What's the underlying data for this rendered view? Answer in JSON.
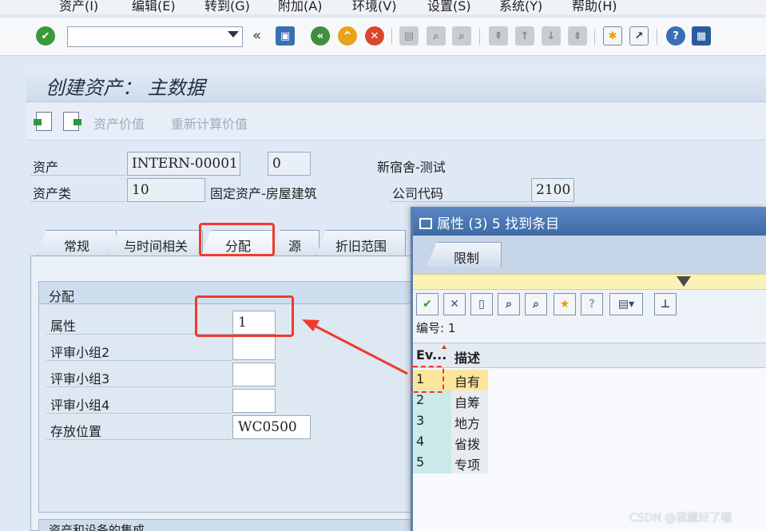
{
  "menu": [
    "资产(I)",
    "编辑(E)",
    "转到(G)",
    "附加(A)",
    "环境(V)",
    "设置(S)",
    "系统(Y)",
    "帮助(H)"
  ],
  "toolbar": {
    "command_value": "",
    "back_chevrons": "«"
  },
  "title": "创建资产：  主数据",
  "app_toolbar": {
    "asset_values": "资产价值",
    "recalc_values": "重新计算价值"
  },
  "header": {
    "asset_label": "资产",
    "asset_number": "INTERN-00001",
    "sub_number": "0",
    "asset_desc": "新宿舍-测试",
    "class_label": "资产类",
    "class_value": "10",
    "class_desc": "固定资产-房屋建筑",
    "company_label": "公司代码",
    "company_value": "2100"
  },
  "tabs": [
    "常规",
    "与时间相关",
    "分配",
    "源",
    "折旧范围"
  ],
  "group": {
    "title": "分配",
    "fields": [
      {
        "label": "属性",
        "value": "1"
      },
      {
        "label": "评审小组2",
        "value": ""
      },
      {
        "label": "评审小组3",
        "value": ""
      },
      {
        "label": "评审小组4",
        "value": ""
      },
      {
        "label": "存放位置",
        "value": "WC0500"
      }
    ],
    "next_group_title": "资产和设备的集成"
  },
  "popup": {
    "title": "属性 (3)   5 找到条目",
    "tab": "限制",
    "number_label": "编号: 1",
    "col_key": "Ev...",
    "col_desc": "描述",
    "rows": [
      {
        "key": "1",
        "desc": "自有"
      },
      {
        "key": "2",
        "desc": "自筹"
      },
      {
        "key": "3",
        "desc": "地方"
      },
      {
        "key": "4",
        "desc": "省拨"
      },
      {
        "key": "5",
        "desc": "专项"
      }
    ]
  },
  "watermark": "CSDN @我藏好了喔",
  "colors": {
    "annotation": "#f03a2c",
    "popup_header": "#4a78b6",
    "selected_row": "#fde69c"
  }
}
